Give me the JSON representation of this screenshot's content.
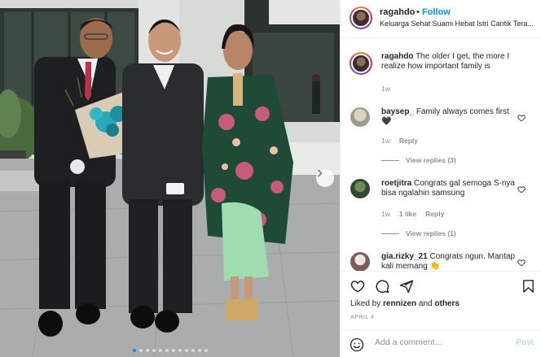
{
  "post": {
    "username": "ragahdo",
    "separator": "•",
    "follow_label": "Follow",
    "caption_preview": "Keluarga Sehat Suami Hebat Istri Cantik Tera...",
    "caption_username": "ragahdo",
    "caption_text": "The older I get, the more I realize how important family is",
    "caption_age": "1w",
    "carousel": {
      "slides": 12,
      "active_index": 0
    }
  },
  "comments": [
    {
      "username": "baysep_",
      "text": "Family always comes first 🖤",
      "age": "1w",
      "likes": "",
      "reply_label": "Reply",
      "view_replies": "View replies (3)"
    },
    {
      "username": "roetjitra",
      "text": "Congrats gal semoga S-nya bisa ngalahin samsung",
      "age": "1w",
      "likes": "1 like",
      "reply_label": "Reply",
      "view_replies": "View replies (1)"
    },
    {
      "username": "gia.rizky_21",
      "text": "Congrats ngun. Mantap kali memang 👏",
      "age": "",
      "likes": "",
      "reply_label": "",
      "view_replies": ""
    }
  ],
  "actions": {
    "liked_prefix": "Liked by ",
    "liked_user": "rennizen",
    "liked_and": " and ",
    "liked_others": "others",
    "date": "APRIL 4"
  },
  "add_comment": {
    "placeholder": "Add a comment…",
    "post_label": "Post"
  },
  "colors": {
    "accent": "#0095f6",
    "text": "#262626",
    "muted": "#8e8e8e",
    "post_disabled": "#b2dffc"
  },
  "icons": [
    "chevron-right-icon",
    "heart-icon",
    "comment-icon",
    "share-icon",
    "bookmark-icon",
    "emoji-icon"
  ]
}
